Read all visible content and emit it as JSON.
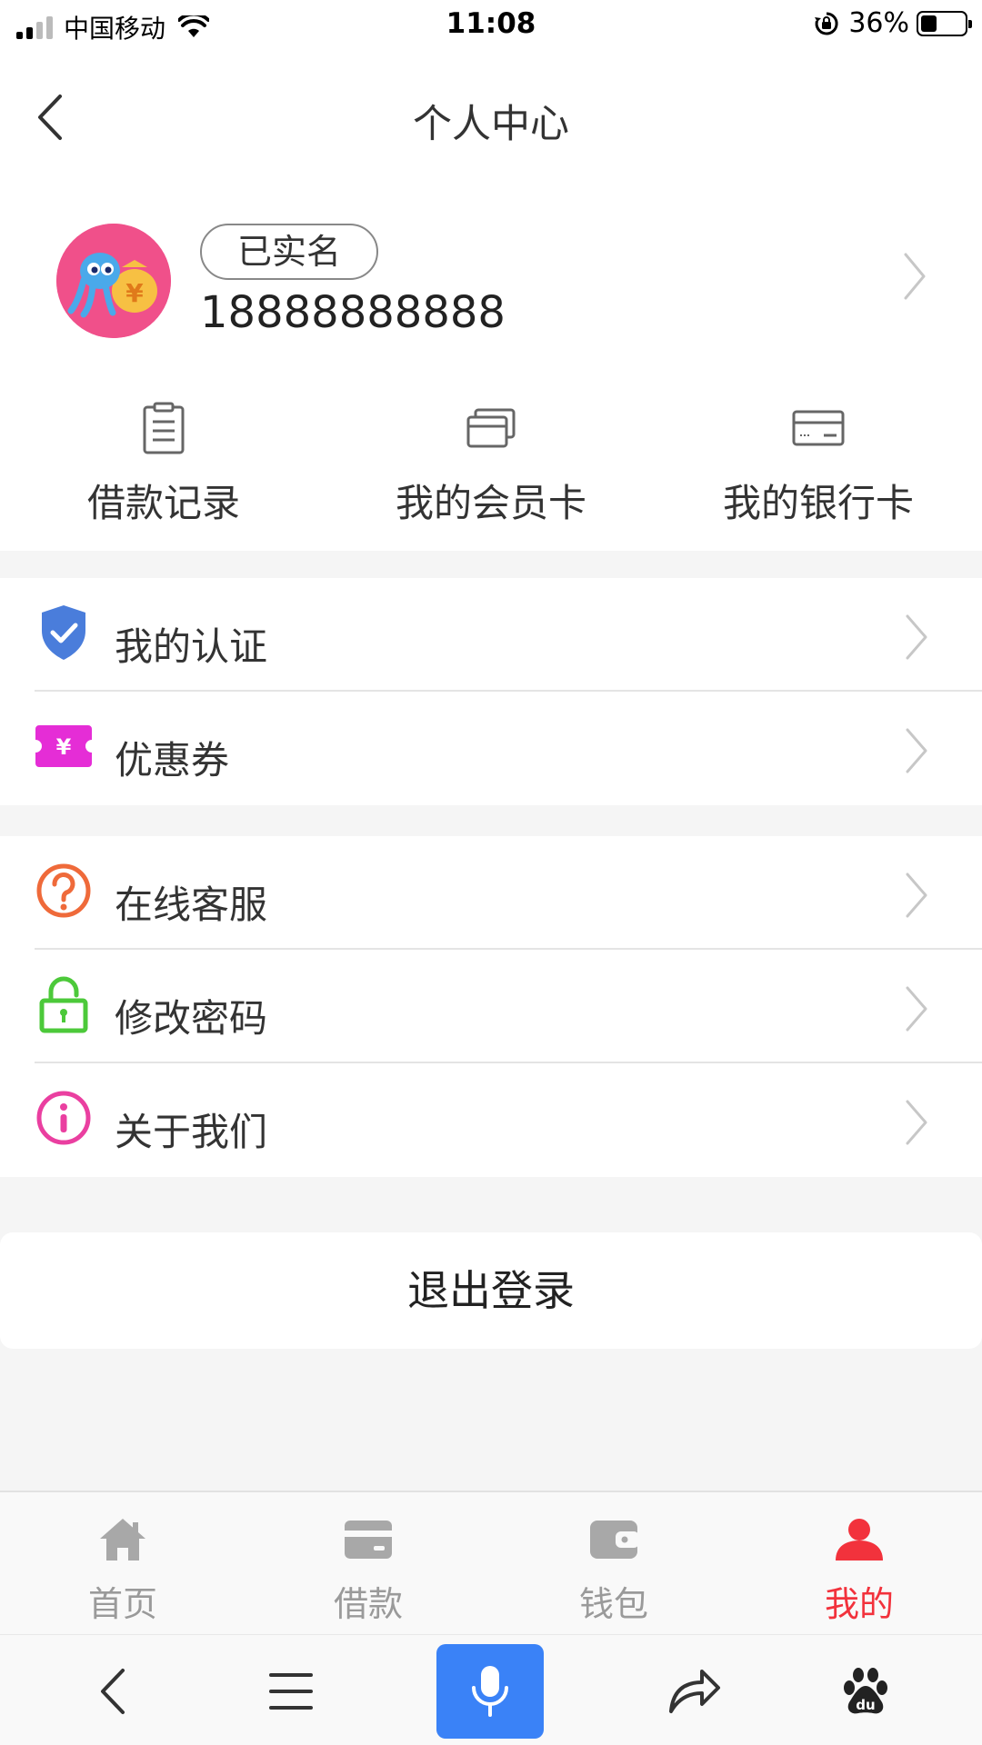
{
  "status_bar": {
    "carrier": "中国移动",
    "time": "11:08",
    "battery": "36%"
  },
  "nav": {
    "title": "个人中心"
  },
  "profile": {
    "verified_label": "已实名",
    "phone": "18888888888"
  },
  "quick_actions": [
    {
      "label": "借款记录",
      "icon": "clipboard-icon"
    },
    {
      "label": "我的会员卡",
      "icon": "cards-icon"
    },
    {
      "label": "我的银行卡",
      "icon": "bank-card-icon"
    }
  ],
  "menu_group_1": [
    {
      "label": "我的认证",
      "icon": "shield-check-icon"
    },
    {
      "label": "优惠券",
      "icon": "coupon-icon"
    }
  ],
  "menu_group_2": [
    {
      "label": "在线客服",
      "icon": "help-icon"
    },
    {
      "label": "修改密码",
      "icon": "lock-icon"
    },
    {
      "label": "关于我们",
      "icon": "info-icon"
    }
  ],
  "logout_label": "退出登录",
  "tabs": [
    {
      "label": "首页",
      "icon": "home-icon"
    },
    {
      "label": "借款",
      "icon": "card-icon"
    },
    {
      "label": "钱包",
      "icon": "wallet-icon"
    },
    {
      "label": "我的",
      "icon": "user-icon",
      "active": true
    }
  ],
  "colors": {
    "accent_red": "#f2323c",
    "mic_blue": "#3a82f7",
    "avatar_pink": "#f0508a"
  }
}
